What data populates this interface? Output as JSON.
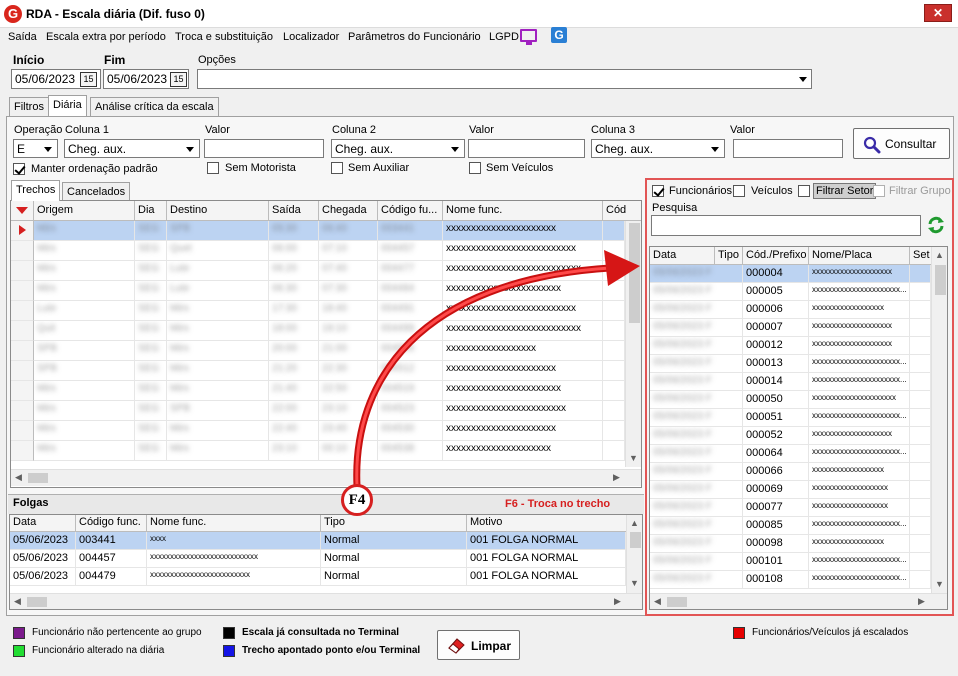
{
  "window": {
    "logo_letter": "G",
    "title": "RDA - Escala diária (Dif. fuso 0)",
    "close_glyph": "✕"
  },
  "menu": [
    "Saída",
    "Escala extra por período",
    "Troca e substituição",
    "Localizador",
    "Parâmetros do Funcionário",
    "LGPD"
  ],
  "icons": {
    "monitor": "monitor-icon",
    "g_logo": "g-logo-icon",
    "calendar": "calendar-icon",
    "search": "search-icon",
    "refresh": "refresh-icon",
    "eraser": "eraser-icon"
  },
  "dates": {
    "inicio_label": "Início",
    "inicio_value": "05/06/2023",
    "fim_label": "Fim",
    "fim_value": "05/06/2023",
    "cal_glyph": "15",
    "opcoes_label": "Opções",
    "opcoes_value": ""
  },
  "tabs": [
    "Filtros",
    "Diária",
    "Análise crítica da escala"
  ],
  "filters": {
    "operacao_label": "Operação",
    "operacao_value": "E",
    "coluna1_label": "Coluna 1",
    "coluna1_value": "Cheg. aux.",
    "valor_label": "Valor",
    "coluna2_label": "Coluna 2",
    "coluna2_value": "Cheg. aux.",
    "coluna3_label": "Coluna 3",
    "coluna3_value": "Cheg. aux.",
    "consultar_label": "Consultar",
    "manter_label": "Manter ordenação padrão",
    "sem_motorista": "Sem Motorista",
    "sem_auxiliar": "Sem Auxiliar",
    "sem_veiculos": "Sem Veículos"
  },
  "trechos": {
    "tabs": [
      "Trechos",
      "Cancelados"
    ],
    "columns": [
      "Origem",
      "Dia",
      "Destino",
      "Saída",
      "Chegada",
      "Código fu...",
      "Nome func.",
      "Cód"
    ],
    "rows": [
      {
        "origem": "Mirs",
        "dia": "SEG",
        "destino": "SPB",
        "saida": "05:30",
        "chegada": "06:40",
        "codigo": "003441",
        "nome": "xxxxxxxxxxxxxxxxxxxxxx"
      },
      {
        "origem": "Mirs",
        "dia": "SEG",
        "destino": "Quet",
        "saida": "06:00",
        "chegada": "07:10",
        "codigo": "004457",
        "nome": "xxxxxxxxxxxxxxxxxxxxxxxxxx"
      },
      {
        "origem": "Mirs",
        "dia": "SEG",
        "destino": "Lute",
        "saida": "06:20",
        "chegada": "07:40",
        "codigo": "004477",
        "nome": "xxxxxxxxxxxxxxxxxxxxxxxxxxx"
      },
      {
        "origem": "Mirs",
        "dia": "SEG",
        "destino": "Lute",
        "saida": "06:30",
        "chegada": "07:30",
        "codigo": "004484",
        "nome": "xxxxxxxxxxxxxxxxxxxxxxx"
      },
      {
        "origem": "Lute",
        "dia": "SEG",
        "destino": "Mirs",
        "saida": "17:30",
        "chegada": "18:40",
        "codigo": "004491",
        "nome": "xxxxxxxxxxxxxxxxxxxxxxxxxx"
      },
      {
        "origem": "Quit",
        "dia": "SEG",
        "destino": "Mirs",
        "saida": "18:00",
        "chegada": "19:10",
        "codigo": "004499",
        "nome": "xxxxxxxxxxxxxxxxxxxxxxxxxxx"
      },
      {
        "origem": "SPB",
        "dia": "SEG",
        "destino": "Mirs",
        "saida": "20:00",
        "chegada": "21:00",
        "codigo": "004506",
        "nome": "xxxxxxxxxxxxxxxxxx"
      },
      {
        "origem": "SPB",
        "dia": "SEG",
        "destino": "Mirs",
        "saida": "21:20",
        "chegada": "22:30",
        "codigo": "004512",
        "nome": "xxxxxxxxxxxxxxxxxxxxxx"
      },
      {
        "origem": "Mirs",
        "dia": "SEG",
        "destino": "Mirs",
        "saida": "21:40",
        "chegada": "22:50",
        "codigo": "004519",
        "nome": "xxxxxxxxxxxxxxxxxxxxxxx"
      },
      {
        "origem": "Mirs",
        "dia": "SEG",
        "destino": "SPB",
        "saida": "22:00",
        "chegada": "23:10",
        "codigo": "004523",
        "nome": "xxxxxxxxxxxxxxxxxxxxxxxx"
      },
      {
        "origem": "Mirs",
        "dia": "SEG",
        "destino": "Mirs",
        "saida": "22:40",
        "chegada": "23:40",
        "codigo": "004530",
        "nome": "xxxxxxxxxxxxxxxxxxxxxx"
      },
      {
        "origem": "Mirs",
        "dia": "SEG",
        "destino": "Mirs",
        "saida": "23:10",
        "chegada": "00:10",
        "codigo": "004538",
        "nome": "xxxxxxxxxxxxxxxxxxxxx"
      }
    ]
  },
  "folgas": {
    "title": "Folgas",
    "callout": "F4",
    "hint": "F6 - Troca no trecho",
    "columns": [
      "Data",
      "Código func.",
      "Nome func.",
      "Tipo",
      "Motivo"
    ],
    "rows": [
      {
        "data": "05/06/2023",
        "codigo": "003441",
        "nome": "xxxx",
        "tipo": "Normal",
        "motivo": "001 FOLGA NORMAL"
      },
      {
        "data": "05/06/2023",
        "codigo": "004457",
        "nome": "xxxxxxxxxxxxxxxxxxxxxxxxxxx",
        "tipo": "Normal",
        "motivo": "001 FOLGA NORMAL"
      },
      {
        "data": "05/06/2023",
        "codigo": "004479",
        "nome": "xxxxxxxxxxxxxxxxxxxxxxxxx",
        "tipo": "Normal",
        "motivo": "001 FOLGA NORMAL"
      }
    ]
  },
  "right": {
    "funcionarios": "Funcionários",
    "veiculos": "Veículos",
    "filtrar_setor": "Filtrar Setor",
    "filtrar_grupo": "Filtrar Grupo",
    "pesquisa_label": "Pesquisa",
    "columns": [
      "Data",
      "Tipo",
      "Cód./Prefixo",
      "Nome/Placa",
      "Set"
    ],
    "rows": [
      {
        "data": "05/06/2023 F",
        "cod": "000004",
        "nome": "xxxxxxxxxxxxxxxxxxxx"
      },
      {
        "data": "05/06/2023 F",
        "cod": "000005",
        "nome": "xxxxxxxxxxxxxxxxxxxxxx..."
      },
      {
        "data": "05/06/2023 F",
        "cod": "000006",
        "nome": "xxxxxxxxxxxxxxxxxx"
      },
      {
        "data": "05/06/2023 F",
        "cod": "000007",
        "nome": "xxxxxxxxxxxxxxxxxxxx"
      },
      {
        "data": "05/06/2023 F",
        "cod": "000012",
        "nome": "xxxxxxxxxxxxxxxxxxxx"
      },
      {
        "data": "05/06/2023 F",
        "cod": "000013",
        "nome": "xxxxxxxxxxxxxxxxxxxxxx..."
      },
      {
        "data": "05/06/2023 F",
        "cod": "000014",
        "nome": "xxxxxxxxxxxxxxxxxxxxxx..."
      },
      {
        "data": "05/06/2023 F",
        "cod": "000050",
        "nome": "xxxxxxxxxxxxxxxxxxxxx"
      },
      {
        "data": "05/06/2023 F",
        "cod": "000051",
        "nome": "xxxxxxxxxxxxxxxxxxxxxx..."
      },
      {
        "data": "05/06/2023 F",
        "cod": "000052",
        "nome": "xxxxxxxxxxxxxxxxxxxx"
      },
      {
        "data": "05/06/2023 F",
        "cod": "000064",
        "nome": "xxxxxxxxxxxxxxxxxxxxxx..."
      },
      {
        "data": "05/06/2023 F",
        "cod": "000066",
        "nome": "xxxxxxxxxxxxxxxxxx"
      },
      {
        "data": "05/06/2023 F",
        "cod": "000069",
        "nome": "xxxxxxxxxxxxxxxxxxx"
      },
      {
        "data": "05/06/2023 F",
        "cod": "000077",
        "nome": "xxxxxxxxxxxxxxxxxxx"
      },
      {
        "data": "05/06/2023 F",
        "cod": "000085",
        "nome": "xxxxxxxxxxxxxxxxxxxxxx..."
      },
      {
        "data": "05/06/2023 F",
        "cod": "000098",
        "nome": "xxxxxxxxxxxxxxxxxx"
      },
      {
        "data": "05/06/2023 F",
        "cod": "000101",
        "nome": "xxxxxxxxxxxxxxxxxxxxxx..."
      },
      {
        "data": "05/06/2023 F",
        "cod": "000108",
        "nome": "xxxxxxxxxxxxxxxxxxxxxx..."
      }
    ]
  },
  "legend": {
    "items": [
      {
        "color": "#7b1a8c",
        "label": "Funcionário não pertencente ao grupo",
        "bold": false
      },
      {
        "color": "#22dd33",
        "label": "Funcionário alterado na diária",
        "bold": false
      },
      {
        "color": "#000000",
        "label": "Escala já consultada no Terminal",
        "bold": true
      },
      {
        "color": "#1414e6",
        "label": "Trecho apontado ponto e/ou Terminal",
        "bold": true
      },
      {
        "color": "#e60000",
        "label": "Funcionários/Veículos já escalados",
        "bold": false
      }
    ],
    "limpar_label": "Limpar"
  },
  "colors": {
    "accent_red": "#d62020",
    "selection": "#bcd3f2",
    "link_purple": "#a020c0"
  }
}
